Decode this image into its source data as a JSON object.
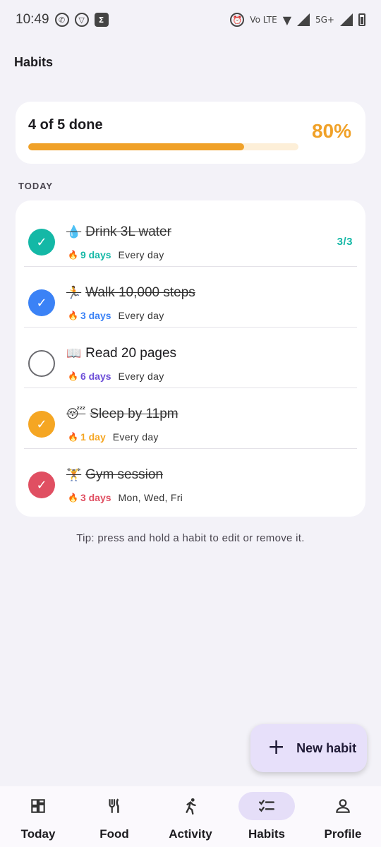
{
  "status_bar": {
    "time": "10:49",
    "icons_left": [
      "whatsapp-icon",
      "vpn-icon",
      "sigma-icon"
    ],
    "icons_right": [
      "alarm-icon",
      "volte-icon",
      "wifi-icon",
      "signal-icon",
      "5g-signal-icon",
      "battery-icon"
    ],
    "volte_text": "Vo LTE",
    "network_text": "5G+"
  },
  "header": {
    "title": "Habits"
  },
  "summary": {
    "text": "4 of 5 done",
    "percent_label": "80%",
    "progress": 0.8,
    "accent_color": "#f0a128"
  },
  "section": {
    "label": "TODAY"
  },
  "habits": [
    {
      "emoji": "💧",
      "title": "Drink 3L water",
      "done": true,
      "color": "#14b8a6",
      "streak": "9 days",
      "frequency": "Every day",
      "count": "3/3"
    },
    {
      "emoji": "🏃",
      "title": "Walk 10,000 steps",
      "done": true,
      "color": "#3b82f6",
      "streak": "3 days",
      "frequency": "Every day",
      "count": ""
    },
    {
      "emoji": "📖",
      "title": "Read 20 pages",
      "done": false,
      "color": "#6d4fd8",
      "streak": "6 days",
      "frequency": "Every day",
      "count": ""
    },
    {
      "emoji": "😴",
      "title": "Sleep by 11pm",
      "done": true,
      "color": "#f5a623",
      "streak": "1 day",
      "frequency": "Every day",
      "count": ""
    },
    {
      "emoji": "🏋",
      "title": "Gym session",
      "done": true,
      "color": "#e04f62",
      "streak": "3 days",
      "frequency": "Mon, Wed, Fri",
      "count": ""
    }
  ],
  "tip": "Tip: press and hold a habit to edit or remove it.",
  "fab": {
    "label": "New habit",
    "icon": "plus-icon"
  },
  "nav": [
    {
      "label": "Today",
      "icon": "dashboard-icon",
      "active": false
    },
    {
      "label": "Food",
      "icon": "fork-knife-icon",
      "active": false
    },
    {
      "label": "Activity",
      "icon": "running-icon",
      "active": false
    },
    {
      "label": "Habits",
      "icon": "checklist-icon",
      "active": true
    },
    {
      "label": "Profile",
      "icon": "person-icon",
      "active": false
    }
  ]
}
